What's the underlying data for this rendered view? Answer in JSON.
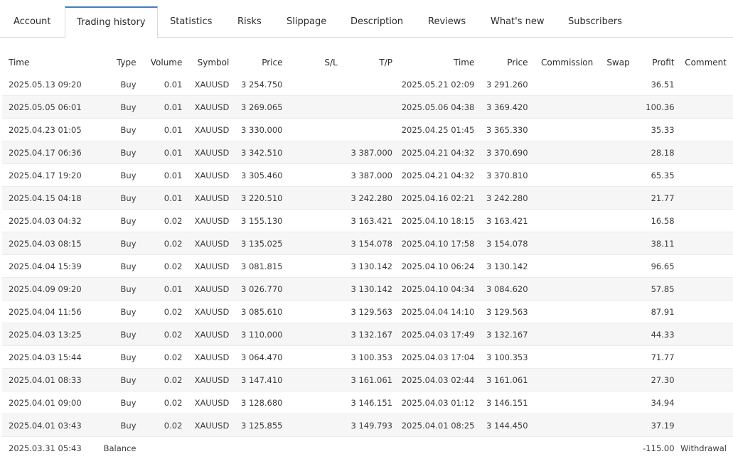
{
  "tabs": [
    {
      "label": "Account"
    },
    {
      "label": "Trading history"
    },
    {
      "label": "Statistics"
    },
    {
      "label": "Risks"
    },
    {
      "label": "Slippage"
    },
    {
      "label": "Description"
    },
    {
      "label": "Reviews"
    },
    {
      "label": "What's new"
    },
    {
      "label": "Subscribers"
    }
  ],
  "active_tab": "Trading history",
  "colors": {
    "accent": "#4a7bb7",
    "profit": "#36578f",
    "loss": "#c92a2a"
  },
  "table": {
    "headers": {
      "open_time": "Time",
      "type": "Type",
      "volume": "Volume",
      "symbol": "Symbol",
      "open_price": "Price",
      "sl": "S/L",
      "tp": "T/P",
      "close_time": "Time",
      "close_price": "Price",
      "commission": "Commission",
      "swap": "Swap",
      "profit": "Profit",
      "comment": "Comment"
    },
    "rows": [
      {
        "open_time": "2025.05.13 09:20",
        "type": "Buy",
        "volume": "0.01",
        "symbol": "XAUUSD",
        "open_price": "3 254.750",
        "sl": "",
        "tp": "",
        "close_time": "2025.05.21 02:09",
        "close_price": "3 291.260",
        "commission": "",
        "swap": "",
        "profit": "36.51",
        "comment": ""
      },
      {
        "open_time": "2025.05.05 06:01",
        "type": "Buy",
        "volume": "0.01",
        "symbol": "XAUUSD",
        "open_price": "3 269.065",
        "sl": "",
        "tp": "",
        "close_time": "2025.05.06 04:38",
        "close_price": "3 369.420",
        "commission": "",
        "swap": "",
        "profit": "100.36",
        "comment": ""
      },
      {
        "open_time": "2025.04.23 01:05",
        "type": "Buy",
        "volume": "0.01",
        "symbol": "XAUUSD",
        "open_price": "3 330.000",
        "sl": "",
        "tp": "",
        "close_time": "2025.04.25 01:45",
        "close_price": "3 365.330",
        "commission": "",
        "swap": "",
        "profit": "35.33",
        "comment": ""
      },
      {
        "open_time": "2025.04.17 06:36",
        "type": "Buy",
        "volume": "0.01",
        "symbol": "XAUUSD",
        "open_price": "3 342.510",
        "sl": "",
        "tp": "3 387.000",
        "close_time": "2025.04.21 04:32",
        "close_price": "3 370.690",
        "commission": "",
        "swap": "",
        "profit": "28.18",
        "comment": ""
      },
      {
        "open_time": "2025.04.17 19:20",
        "type": "Buy",
        "volume": "0.01",
        "symbol": "XAUUSD",
        "open_price": "3 305.460",
        "sl": "",
        "tp": "3 387.000",
        "close_time": "2025.04.21 04:32",
        "close_price": "3 370.810",
        "commission": "",
        "swap": "",
        "profit": "65.35",
        "comment": ""
      },
      {
        "open_time": "2025.04.15 04:18",
        "type": "Buy",
        "volume": "0.01",
        "symbol": "XAUUSD",
        "open_price": "3 220.510",
        "sl": "",
        "tp": "3 242.280",
        "close_time": "2025.04.16 02:21",
        "close_price": "3 242.280",
        "commission": "",
        "swap": "",
        "profit": "21.77",
        "comment": ""
      },
      {
        "open_time": "2025.04.03 04:32",
        "type": "Buy",
        "volume": "0.02",
        "symbol": "XAUUSD",
        "open_price": "3 155.130",
        "sl": "",
        "tp": "3 163.421",
        "close_time": "2025.04.10 18:15",
        "close_price": "3 163.421",
        "commission": "",
        "swap": "",
        "profit": "16.58",
        "comment": ""
      },
      {
        "open_time": "2025.04.03 08:15",
        "type": "Buy",
        "volume": "0.02",
        "symbol": "XAUUSD",
        "open_price": "3 135.025",
        "sl": "",
        "tp": "3 154.078",
        "close_time": "2025.04.10 17:58",
        "close_price": "3 154.078",
        "commission": "",
        "swap": "",
        "profit": "38.11",
        "comment": ""
      },
      {
        "open_time": "2025.04.04 15:39",
        "type": "Buy",
        "volume": "0.02",
        "symbol": "XAUUSD",
        "open_price": "3 081.815",
        "sl": "",
        "tp": "3 130.142",
        "close_time": "2025.04.10 06:24",
        "close_price": "3 130.142",
        "commission": "",
        "swap": "",
        "profit": "96.65",
        "comment": ""
      },
      {
        "open_time": "2025.04.09 09:20",
        "type": "Buy",
        "volume": "0.01",
        "symbol": "XAUUSD",
        "open_price": "3 026.770",
        "sl": "",
        "tp": "3 130.142",
        "close_time": "2025.04.10 04:34",
        "close_price": "3 084.620",
        "commission": "",
        "swap": "",
        "profit": "57.85",
        "comment": ""
      },
      {
        "open_time": "2025.04.04 11:56",
        "type": "Buy",
        "volume": "0.02",
        "symbol": "XAUUSD",
        "open_price": "3 085.610",
        "sl": "",
        "tp": "3 129.563",
        "close_time": "2025.04.04 14:10",
        "close_price": "3 129.563",
        "commission": "",
        "swap": "",
        "profit": "87.91",
        "comment": ""
      },
      {
        "open_time": "2025.04.03 13:25",
        "type": "Buy",
        "volume": "0.02",
        "symbol": "XAUUSD",
        "open_price": "3 110.000",
        "sl": "",
        "tp": "3 132.167",
        "close_time": "2025.04.03 17:49",
        "close_price": "3 132.167",
        "commission": "",
        "swap": "",
        "profit": "44.33",
        "comment": ""
      },
      {
        "open_time": "2025.04.03 15:44",
        "type": "Buy",
        "volume": "0.02",
        "symbol": "XAUUSD",
        "open_price": "3 064.470",
        "sl": "",
        "tp": "3 100.353",
        "close_time": "2025.04.03 17:04",
        "close_price": "3 100.353",
        "commission": "",
        "swap": "",
        "profit": "71.77",
        "comment": ""
      },
      {
        "open_time": "2025.04.01 08:33",
        "type": "Buy",
        "volume": "0.02",
        "symbol": "XAUUSD",
        "open_price": "3 147.410",
        "sl": "",
        "tp": "3 161.061",
        "close_time": "2025.04.03 02:44",
        "close_price": "3 161.061",
        "commission": "",
        "swap": "",
        "profit": "27.30",
        "comment": ""
      },
      {
        "open_time": "2025.04.01 09:00",
        "type": "Buy",
        "volume": "0.02",
        "symbol": "XAUUSD",
        "open_price": "3 128.680",
        "sl": "",
        "tp": "3 146.151",
        "close_time": "2025.04.03 01:12",
        "close_price": "3 146.151",
        "commission": "",
        "swap": "",
        "profit": "34.94",
        "comment": ""
      },
      {
        "open_time": "2025.04.01 03:43",
        "type": "Buy",
        "volume": "0.02",
        "symbol": "XAUUSD",
        "open_price": "3 125.855",
        "sl": "",
        "tp": "3 149.793",
        "close_time": "2025.04.01 08:25",
        "close_price": "3 144.450",
        "commission": "",
        "swap": "",
        "profit": "37.19",
        "comment": ""
      }
    ],
    "balance_row": {
      "open_time": "2025.03.31 05:43",
      "type": "Balance",
      "profit": "-115.00",
      "comment": "Withdrawal"
    }
  }
}
